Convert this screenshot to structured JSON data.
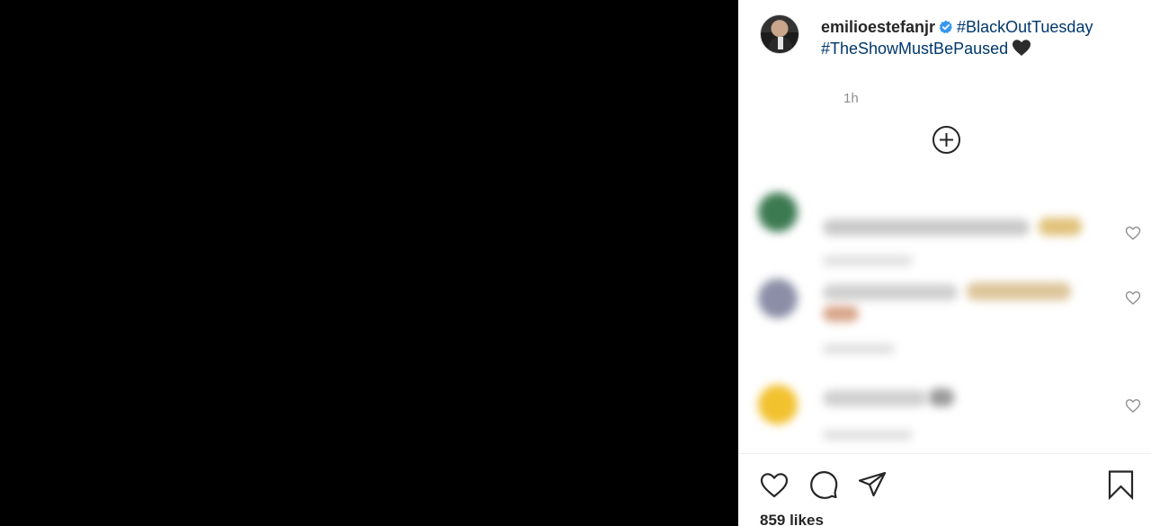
{
  "post": {
    "username": "emilioestefanjr",
    "hashtag_1": "#BlackOutTuesday",
    "hashtag_2": "#TheShowMustBePaused",
    "time": "1h",
    "likes": "859 likes"
  },
  "icons": {
    "verified": "verified-badge-icon",
    "caption_emoji": "black-heart-emoji-icon",
    "load_more": "plus-circle-icon",
    "comment_like": "heart-outline-icon",
    "like": "heart-outline-icon",
    "comment": "speech-bubble-icon",
    "share": "paper-plane-icon",
    "save": "bookmark-icon"
  },
  "colors": {
    "hashtag": "#00376b",
    "verified": "#3897f0",
    "text": "#262626",
    "muted": "#8e8e8e"
  }
}
